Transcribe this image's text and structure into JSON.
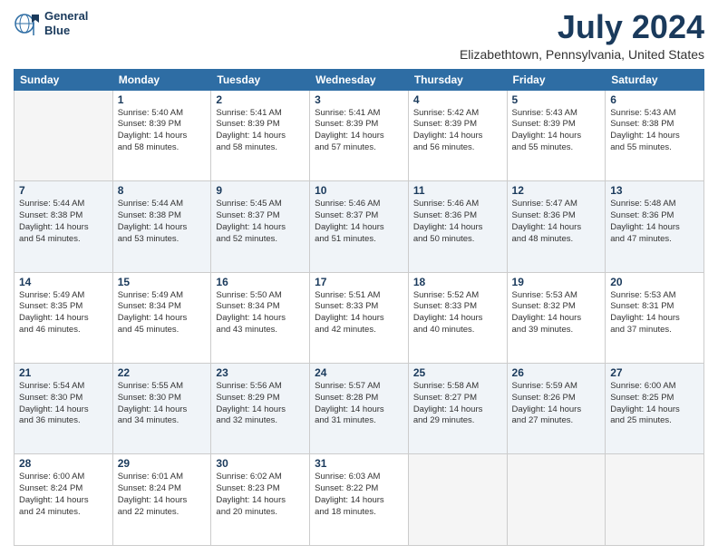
{
  "logo": {
    "line1": "General",
    "line2": "Blue"
  },
  "title": "July 2024",
  "subtitle": "Elizabethtown, Pennsylvania, United States",
  "days_of_week": [
    "Sunday",
    "Monday",
    "Tuesday",
    "Wednesday",
    "Thursday",
    "Friday",
    "Saturday"
  ],
  "weeks": [
    [
      {
        "day": "",
        "info": ""
      },
      {
        "day": "1",
        "info": "Sunrise: 5:40 AM\nSunset: 8:39 PM\nDaylight: 14 hours\nand 58 minutes."
      },
      {
        "day": "2",
        "info": "Sunrise: 5:41 AM\nSunset: 8:39 PM\nDaylight: 14 hours\nand 58 minutes."
      },
      {
        "day": "3",
        "info": "Sunrise: 5:41 AM\nSunset: 8:39 PM\nDaylight: 14 hours\nand 57 minutes."
      },
      {
        "day": "4",
        "info": "Sunrise: 5:42 AM\nSunset: 8:39 PM\nDaylight: 14 hours\nand 56 minutes."
      },
      {
        "day": "5",
        "info": "Sunrise: 5:43 AM\nSunset: 8:39 PM\nDaylight: 14 hours\nand 55 minutes."
      },
      {
        "day": "6",
        "info": "Sunrise: 5:43 AM\nSunset: 8:38 PM\nDaylight: 14 hours\nand 55 minutes."
      }
    ],
    [
      {
        "day": "7",
        "info": "Sunrise: 5:44 AM\nSunset: 8:38 PM\nDaylight: 14 hours\nand 54 minutes."
      },
      {
        "day": "8",
        "info": "Sunrise: 5:44 AM\nSunset: 8:38 PM\nDaylight: 14 hours\nand 53 minutes."
      },
      {
        "day": "9",
        "info": "Sunrise: 5:45 AM\nSunset: 8:37 PM\nDaylight: 14 hours\nand 52 minutes."
      },
      {
        "day": "10",
        "info": "Sunrise: 5:46 AM\nSunset: 8:37 PM\nDaylight: 14 hours\nand 51 minutes."
      },
      {
        "day": "11",
        "info": "Sunrise: 5:46 AM\nSunset: 8:36 PM\nDaylight: 14 hours\nand 50 minutes."
      },
      {
        "day": "12",
        "info": "Sunrise: 5:47 AM\nSunset: 8:36 PM\nDaylight: 14 hours\nand 48 minutes."
      },
      {
        "day": "13",
        "info": "Sunrise: 5:48 AM\nSunset: 8:36 PM\nDaylight: 14 hours\nand 47 minutes."
      }
    ],
    [
      {
        "day": "14",
        "info": "Sunrise: 5:49 AM\nSunset: 8:35 PM\nDaylight: 14 hours\nand 46 minutes."
      },
      {
        "day": "15",
        "info": "Sunrise: 5:49 AM\nSunset: 8:34 PM\nDaylight: 14 hours\nand 45 minutes."
      },
      {
        "day": "16",
        "info": "Sunrise: 5:50 AM\nSunset: 8:34 PM\nDaylight: 14 hours\nand 43 minutes."
      },
      {
        "day": "17",
        "info": "Sunrise: 5:51 AM\nSunset: 8:33 PM\nDaylight: 14 hours\nand 42 minutes."
      },
      {
        "day": "18",
        "info": "Sunrise: 5:52 AM\nSunset: 8:33 PM\nDaylight: 14 hours\nand 40 minutes."
      },
      {
        "day": "19",
        "info": "Sunrise: 5:53 AM\nSunset: 8:32 PM\nDaylight: 14 hours\nand 39 minutes."
      },
      {
        "day": "20",
        "info": "Sunrise: 5:53 AM\nSunset: 8:31 PM\nDaylight: 14 hours\nand 37 minutes."
      }
    ],
    [
      {
        "day": "21",
        "info": "Sunrise: 5:54 AM\nSunset: 8:30 PM\nDaylight: 14 hours\nand 36 minutes."
      },
      {
        "day": "22",
        "info": "Sunrise: 5:55 AM\nSunset: 8:30 PM\nDaylight: 14 hours\nand 34 minutes."
      },
      {
        "day": "23",
        "info": "Sunrise: 5:56 AM\nSunset: 8:29 PM\nDaylight: 14 hours\nand 32 minutes."
      },
      {
        "day": "24",
        "info": "Sunrise: 5:57 AM\nSunset: 8:28 PM\nDaylight: 14 hours\nand 31 minutes."
      },
      {
        "day": "25",
        "info": "Sunrise: 5:58 AM\nSunset: 8:27 PM\nDaylight: 14 hours\nand 29 minutes."
      },
      {
        "day": "26",
        "info": "Sunrise: 5:59 AM\nSunset: 8:26 PM\nDaylight: 14 hours\nand 27 minutes."
      },
      {
        "day": "27",
        "info": "Sunrise: 6:00 AM\nSunset: 8:25 PM\nDaylight: 14 hours\nand 25 minutes."
      }
    ],
    [
      {
        "day": "28",
        "info": "Sunrise: 6:00 AM\nSunset: 8:24 PM\nDaylight: 14 hours\nand 24 minutes."
      },
      {
        "day": "29",
        "info": "Sunrise: 6:01 AM\nSunset: 8:24 PM\nDaylight: 14 hours\nand 22 minutes."
      },
      {
        "day": "30",
        "info": "Sunrise: 6:02 AM\nSunset: 8:23 PM\nDaylight: 14 hours\nand 20 minutes."
      },
      {
        "day": "31",
        "info": "Sunrise: 6:03 AM\nSunset: 8:22 PM\nDaylight: 14 hours\nand 18 minutes."
      },
      {
        "day": "",
        "info": ""
      },
      {
        "day": "",
        "info": ""
      },
      {
        "day": "",
        "info": ""
      }
    ]
  ]
}
